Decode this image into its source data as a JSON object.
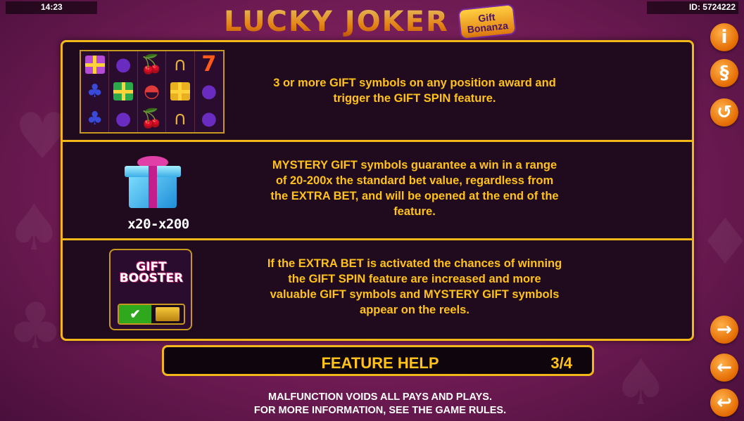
{
  "status": {
    "time": "14:23",
    "game_id": "ID: 5724222"
  },
  "logo": {
    "main": "LUCKY JOKER",
    "sub_line1": "Gift",
    "sub_line2": "Bonanza"
  },
  "help": {
    "rows": [
      {
        "text": "3 or more GIFT symbols on any position award and trigger the GIFT SPIN feature."
      },
      {
        "text": "MYSTERY GIFT symbols guarantee a win in a range of 20-200x the standard bet value, regardless from the EXTRA BET, and will be opened at the end of the feature.",
        "multiplier_label": "x20-x200"
      },
      {
        "text": "If the EXTRA BET is activated the chances of winning the GIFT SPIN feature are increased and more valuable GIFT symbols and MYSTERY GIFT symbols appear on the reels.",
        "booster_line1": "GIFT",
        "booster_line2": "BOOSTER",
        "toggle_check": "✔"
      }
    ]
  },
  "footer": {
    "title": "FEATURE HELP",
    "page": "3/4",
    "legal_line1": "MALFUNCTION VOIDS ALL PAYS AND PLAYS.",
    "legal_line2": "FOR MORE INFORMATION, SEE THE GAME RULES."
  },
  "side_buttons": {
    "info": "i",
    "rules": "§",
    "history": "↺",
    "next": "→",
    "prev": "←",
    "back": "↩"
  },
  "reel_symbols": [
    [
      "gift-purple",
      "plum",
      "cherry",
      "horseshoe",
      "seven"
    ],
    [
      "grape",
      "gift-red",
      "watermelon",
      "gift-blue",
      "plum"
    ],
    [
      "grape",
      "plum",
      "cherry",
      "horseshoe",
      "plum"
    ]
  ],
  "colors": {
    "accent": "#ffc21a",
    "border": "#f2b81a",
    "panel_bg": "#1f0a1e",
    "button": "#e36a00"
  }
}
